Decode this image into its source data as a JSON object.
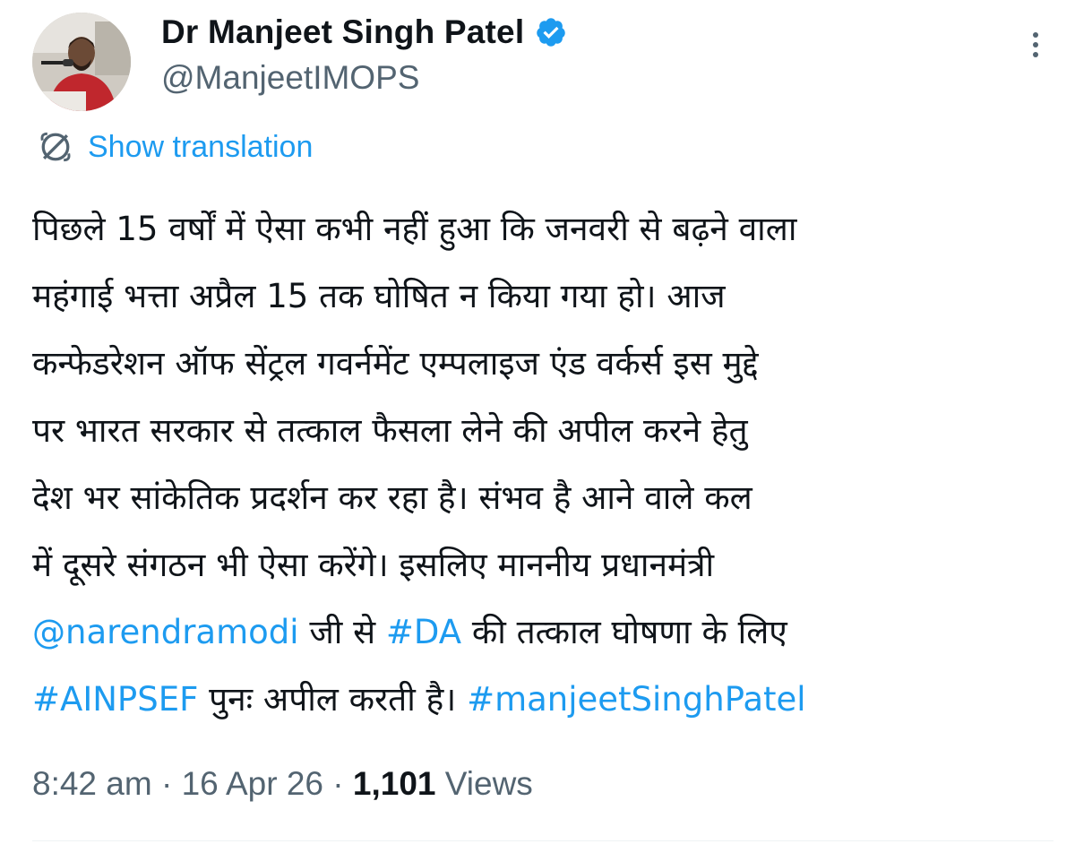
{
  "author": {
    "display_name": "Dr Manjeet Singh Patel",
    "handle": "@ManjeetIMOPS",
    "verified": true
  },
  "actions": {
    "more_icon": "more-horizontal-icon",
    "translate_label": "Show translation",
    "translate_icon": "translate-globe-icon"
  },
  "tweet": {
    "lines": [
      [
        {
          "text": "पिछले 15 वर्षों में ऐसा कभी नहीं हुआ कि जनवरी से बढ़ने वाला",
          "type": "text"
        }
      ],
      [
        {
          "text": "महंगाई भत्ता अप्रैल 15 तक घोषित न किया गया हो। आज",
          "type": "text"
        }
      ],
      [
        {
          "text": "कन्फेडरेशन ऑफ सेंट्रल गवर्नमेंट एम्पलाइज एंड वर्कर्स इस मुद्दे",
          "type": "text"
        }
      ],
      [
        {
          "text": "पर भारत सरकार से तत्काल फैसला लेने की अपील करने हेतु",
          "type": "text"
        }
      ],
      [
        {
          "text": "देश भर सांकेतिक प्रदर्शन कर रहा है। संभव है आने वाले कल",
          "type": "text"
        }
      ],
      [
        {
          "text": "में दूसरे संगठन भी ऐसा करेंगे। इसलिए माननीय प्रधानमंत्री",
          "type": "text"
        }
      ],
      [
        {
          "text": "@narendramodi",
          "type": "mention"
        },
        {
          "text": " जी से ",
          "type": "text"
        },
        {
          "text": "#DA",
          "type": "hashtag"
        },
        {
          "text": " की तत्काल घोषणा के लिए",
          "type": "text"
        }
      ],
      [
        {
          "text": "#AINPSEF",
          "type": "hashtag"
        },
        {
          "text": " पुनः अपील करती है। ",
          "type": "text"
        },
        {
          "text": "#manjeetSinghPatel",
          "type": "hashtag"
        }
      ]
    ]
  },
  "meta": {
    "time": "8:42 am",
    "separator": " · ",
    "date": "16 Apr 26",
    "views_count": "1,101",
    "views_label": " Views"
  },
  "colors": {
    "link": "#1d9bf0",
    "text": "#0f1419",
    "secondary": "#536471",
    "verified_badge": "#1d9bf0"
  }
}
